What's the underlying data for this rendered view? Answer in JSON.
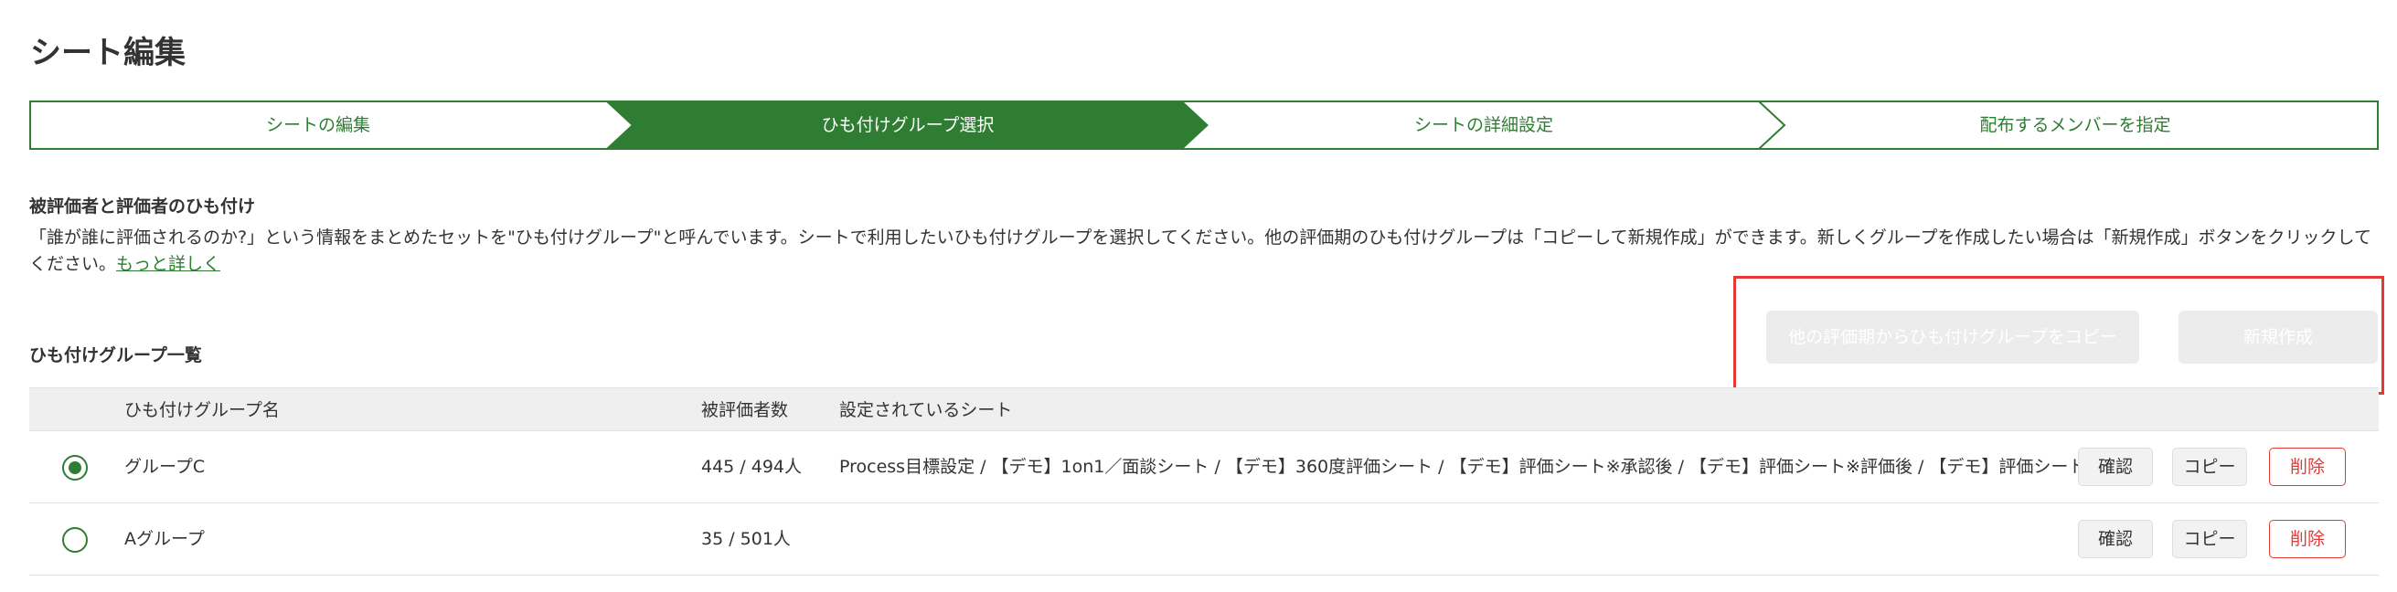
{
  "page": {
    "title": "シート編集"
  },
  "stepper": {
    "steps": [
      {
        "label": "シートの編集",
        "active": false
      },
      {
        "label": "ひも付けグループ選択",
        "active": true
      },
      {
        "label": "シートの詳細設定",
        "active": false
      },
      {
        "label": "配布するメンバーを指定",
        "active": false
      }
    ]
  },
  "linking": {
    "title": "被評価者と評価者のひも付け",
    "description": "「誰が誰に評価されるのか?」という情報をまとめたセットを\"ひも付けグループ\"と呼んでいます。シートで利用したいひも付けグループを選択してください。他の評価期のひも付けグループは「コピーして新規作成」ができます。新しくグループを作成したい場合は「新規作成」ボタンをクリックしてください。",
    "more_link": "もっと詳しく"
  },
  "group_list": {
    "title": "ひも付けグループ一覧",
    "copy_from_other_period_button": "他の評価期からひも付けグループをコピー",
    "create_new_button": "新規作成",
    "columns": {
      "name": "ひも付けグループ名",
      "evaluatee_count": "被評価者数",
      "sheets": "設定されているシート"
    },
    "rows": [
      {
        "selected": true,
        "name": "グループC",
        "evaluatee_count": "445 / 494人",
        "sheets": "Process目標設定 / 【デモ】1on1／面談シート / 【デモ】360度評価シート / 【デモ】評価シート※承認後 / 【デモ】評価シート※評価後 / 【デモ】評価シート（not削除",
        "confirm": "確認",
        "copy": "コピー",
        "delete": "削除"
      },
      {
        "selected": false,
        "name": "Aグループ",
        "evaluatee_count": "35 / 501人",
        "sheets": "",
        "confirm": "確認",
        "copy": "コピー",
        "delete": "削除"
      }
    ]
  },
  "colors": {
    "accent": "#2e7d32",
    "danger": "#e53935",
    "highlight_border": "#e53935"
  }
}
